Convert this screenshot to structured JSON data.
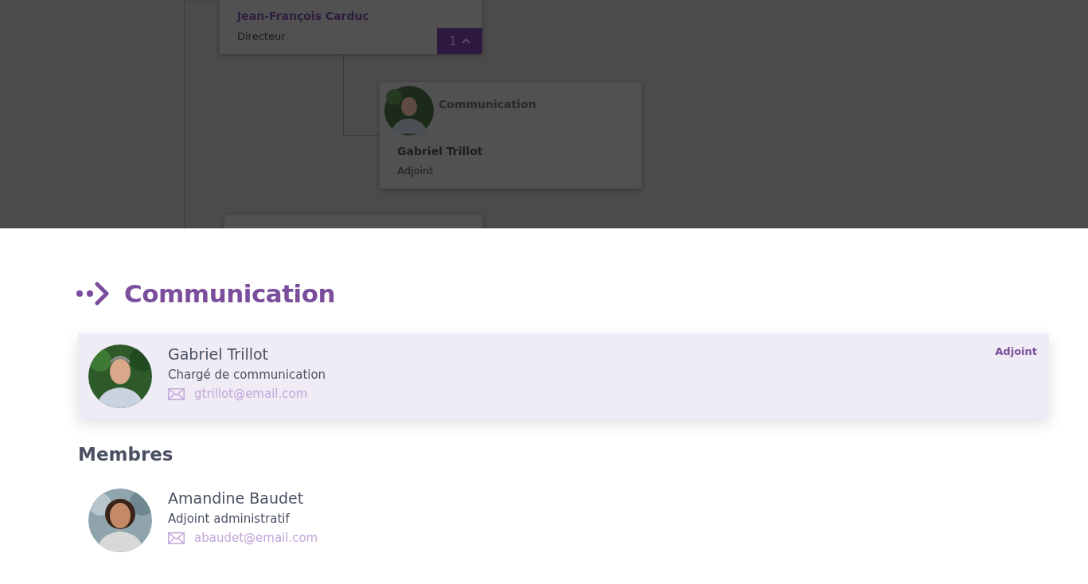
{
  "org_chart": {
    "nodes": [
      {
        "kind": "director",
        "name": "Jean-François Carduc",
        "role": "Directeur",
        "toggle": {
          "count": "1",
          "expanded": true
        }
      },
      {
        "kind": "unit",
        "title": "Communication",
        "name": "Gabriel Trillot",
        "role": "Adjoint"
      },
      {
        "kind": "partial"
      }
    ]
  },
  "panel": {
    "title": "Communication",
    "lead": {
      "name": "Gabriel Trillot",
      "job": "Chargé de communication",
      "email": "gtrillot@email.com",
      "badge": "Adjoint"
    },
    "members_title": "Membres",
    "members": [
      {
        "name": "Amandine Baudet",
        "job": "Adjoint administratif",
        "email": "abaudet@email.com"
      }
    ]
  }
}
